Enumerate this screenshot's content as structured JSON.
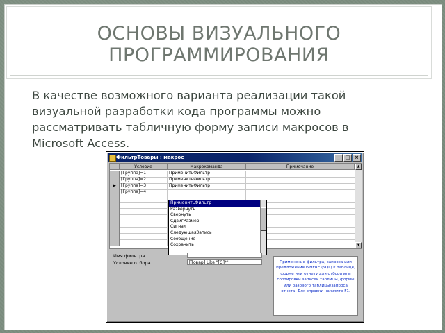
{
  "slide": {
    "title": "ОСНОВЫ ВИЗУАЛЬНОГО\nПРОГРАММИРОВАНИЯ",
    "body": "В качестве возможного варианта реализации такой\nвизуальной разработки кода программы можно\nрассматривать табличную форму записи макросов в\nMicrosoft Access."
  },
  "window": {
    "title": "ФильтрТовары : макрос",
    "buttons": {
      "minimize": "_",
      "maximize": "□",
      "close": "×"
    },
    "columns": [
      "Условие",
      "Макрокоманда",
      "Примечание"
    ],
    "rows": [
      {
        "selector": "",
        "condition": "[Группа]=1",
        "action": "ПрименитьФильтр",
        "note": ""
      },
      {
        "selector": "",
        "condition": "[Группа]=2",
        "action": "ПрименитьФильтр",
        "note": ""
      },
      {
        "selector": "▶",
        "condition": "[Группа]=3",
        "action": "ПрименитьФильтр",
        "note": ""
      },
      {
        "selector": "",
        "condition": "[Группа]=4",
        "action": "",
        "note": ""
      }
    ],
    "dropdown": {
      "items": [
        "ПрименитьФильтр",
        "Развернуть",
        "Свернуть",
        "СдвигРазмер",
        "Сигнал",
        "СледующаяЗапись",
        "Сообщение",
        "Сохранить"
      ],
      "selected_index": 0
    },
    "properties": {
      "filter_label": "Имя фильтра",
      "filter_value": "",
      "where_label": "Условие отбора",
      "where_value": "[Товар] Like \"[G]*\""
    },
    "hint": "Применение фильтра, запроса или предложения WHERE (SQL) к таблице, форме или отчету для отбора или сортировки записей таблицы, формы или базового таблицы/запроса отчета. Для справки нажмите F1."
  }
}
